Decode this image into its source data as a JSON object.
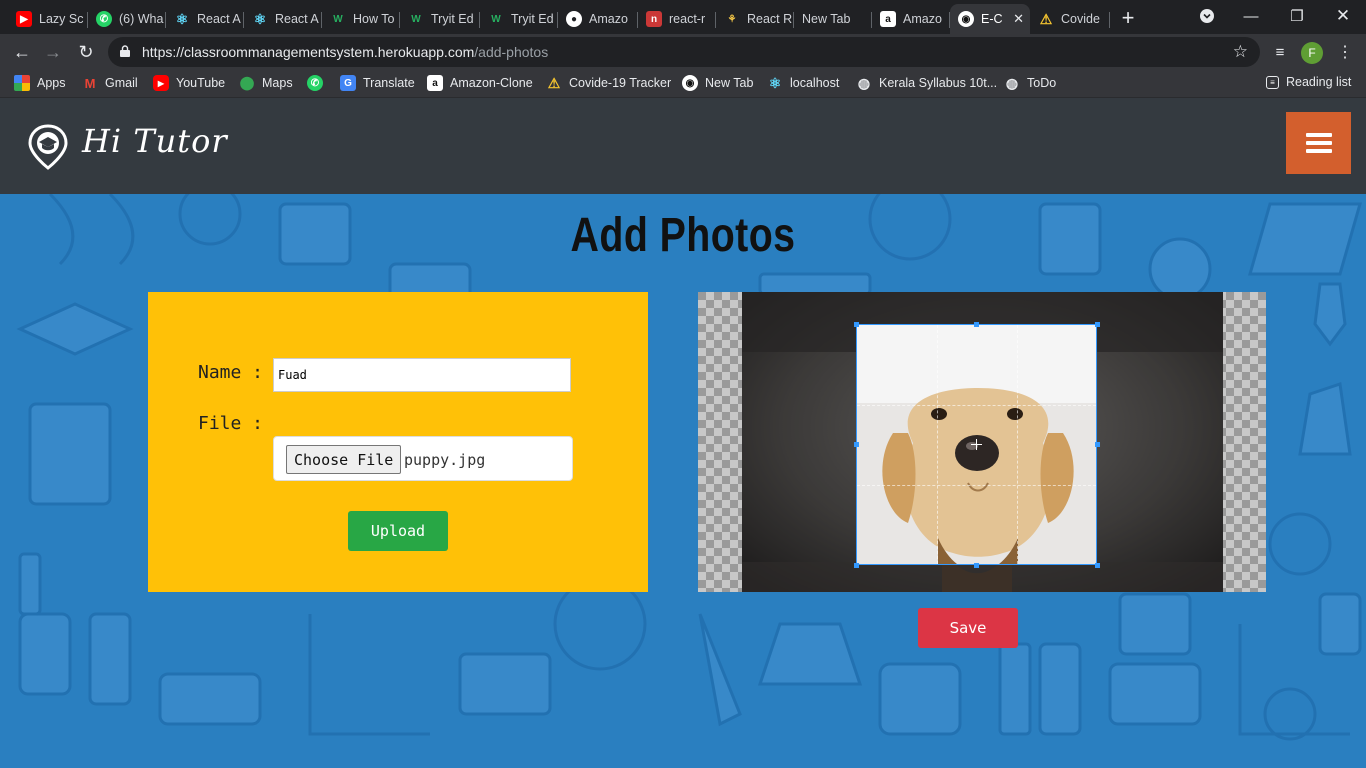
{
  "browser": {
    "tabs": [
      {
        "title": "Lazy Sc",
        "icon": "youtube-icon",
        "color": "#ff0000"
      },
      {
        "title": "(6) Wha",
        "icon": "whatsapp-icon",
        "color": "#25d366"
      },
      {
        "title": "React A",
        "icon": "react-icon",
        "color": "#61dafb"
      },
      {
        "title": "React A",
        "icon": "react-icon",
        "color": "#61dafb"
      },
      {
        "title": "How To",
        "icon": "w-icon",
        "color": "#27ae60"
      },
      {
        "title": "Tryit Ed",
        "icon": "w-icon",
        "color": "#27ae60"
      },
      {
        "title": "Tryit Ed",
        "icon": "w-icon",
        "color": "#27ae60"
      },
      {
        "title": "Amazo",
        "icon": "github-icon",
        "color": "#ffffff"
      },
      {
        "title": "react-r",
        "icon": "npm-icon",
        "color": "#cb3837"
      },
      {
        "title": "React R",
        "icon": "redux-icon",
        "color": "#f7c948"
      },
      {
        "title": "New Tab",
        "icon": "",
        "color": ""
      },
      {
        "title": "Amazo",
        "icon": "amazon-icon",
        "color": "#ffffff"
      },
      {
        "title": "E-C",
        "icon": "location-icon",
        "color": "#ffffff"
      },
      {
        "title": "Covide",
        "icon": "warning-icon",
        "color": "#f4c430"
      }
    ],
    "url_host": "https://classroommanagementsystem.herokuapp.com",
    "url_path": "/add-photos",
    "profile_initial": "F",
    "bookmarks": [
      {
        "label": "Apps"
      },
      {
        "label": "Gmail"
      },
      {
        "label": "YouTube"
      },
      {
        "label": "Maps"
      },
      {
        "label": ""
      },
      {
        "label": "Translate"
      },
      {
        "label": "Amazon-Clone"
      },
      {
        "label": "Covide-19 Tracker"
      },
      {
        "label": "New Tab"
      },
      {
        "label": "localhost"
      },
      {
        "label": "Kerala Syllabus 10t..."
      },
      {
        "label": "ToDo"
      }
    ],
    "reading_list": "Reading list"
  },
  "app": {
    "brand": "Hi Tutor",
    "page_title": "Add Photos",
    "form": {
      "name_label": "Name :",
      "name_value": "Fuad",
      "file_label": "File :",
      "choose_file_label": "Choose File",
      "file_name": "puppy.jpg",
      "upload_label": "Upload"
    },
    "save_label": "Save",
    "colors": {
      "header": "#343a40",
      "menu_button": "#d35f2d",
      "background": "#2a7fc0",
      "form_card": "#ffc107",
      "upload": "#28a745",
      "save": "#dc3545",
      "crop_border": "#3399ff"
    }
  }
}
